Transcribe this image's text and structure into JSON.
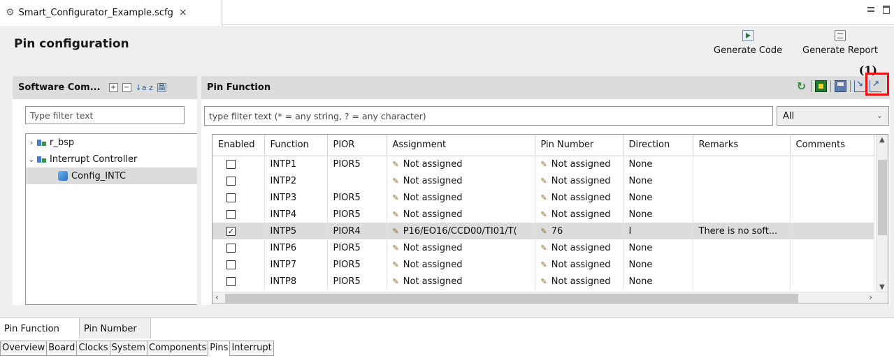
{
  "editor_tab": {
    "filename": "Smart_Configurator_Example.scfg",
    "close": "×"
  },
  "header": {
    "title": "Pin configuration",
    "generate_code": "Generate Code",
    "generate_report": "Generate Report"
  },
  "left_panel": {
    "title": "Software Com...",
    "filter_placeholder": "Type filter text",
    "tree": [
      {
        "label": "r_bsp",
        "expanded": false
      },
      {
        "label": "Interrupt Controller",
        "expanded": true
      },
      {
        "label": "Config_INTC",
        "selected": true
      }
    ]
  },
  "right_panel": {
    "title": "Pin Function",
    "annotation": "(1)",
    "filter_placeholder": "type filter text (* = any string, ? = any character)",
    "select_value": "All",
    "columns": [
      "Enabled",
      "Function",
      "PIOR",
      "Assignment",
      "Pin Number",
      "Direction",
      "Remarks",
      "Comments"
    ],
    "rows": [
      {
        "enabled": false,
        "function": "INTP1",
        "pior": "PIOR5",
        "assignment": "Not assigned",
        "pin": "Not assigned",
        "direction": "None",
        "remarks": "",
        "comments": ""
      },
      {
        "enabled": false,
        "function": "INTP2",
        "pior": "",
        "assignment": "Not assigned",
        "pin": "Not assigned",
        "direction": "None",
        "remarks": "",
        "comments": ""
      },
      {
        "enabled": false,
        "function": "INTP3",
        "pior": "PIOR5",
        "assignment": "Not assigned",
        "pin": "Not assigned",
        "direction": "None",
        "remarks": "",
        "comments": ""
      },
      {
        "enabled": false,
        "function": "INTP4",
        "pior": "PIOR5",
        "assignment": "Not assigned",
        "pin": "Not assigned",
        "direction": "None",
        "remarks": "",
        "comments": ""
      },
      {
        "enabled": true,
        "function": "INTP5",
        "pior": "PIOR4",
        "assignment": "P16/EO16/CCD00/TI01/T(",
        "pin": "76",
        "direction": "I",
        "remarks": "There is no soft...",
        "comments": "",
        "selected": true
      },
      {
        "enabled": false,
        "function": "INTP6",
        "pior": "PIOR5",
        "assignment": "Not assigned",
        "pin": "Not assigned",
        "direction": "None",
        "remarks": "",
        "comments": ""
      },
      {
        "enabled": false,
        "function": "INTP7",
        "pior": "PIOR5",
        "assignment": "Not assigned",
        "pin": "Not assigned",
        "direction": "None",
        "remarks": "",
        "comments": ""
      },
      {
        "enabled": false,
        "function": "INTP8",
        "pior": "PIOR5",
        "assignment": "Not assigned",
        "pin": "Not assigned",
        "direction": "None",
        "remarks": "",
        "comments": ""
      }
    ]
  },
  "sub_tabs": [
    "Pin Function",
    "Pin Number"
  ],
  "page_tabs": [
    "Overview",
    "Board",
    "Clocks",
    "System",
    "Components",
    "Pins",
    "Interrupt"
  ],
  "active_page_tab": "Pins",
  "colors": {
    "highlight": "#e11111",
    "selected_row": "#dcdcdc",
    "panel_header": "#dcdcdc"
  }
}
